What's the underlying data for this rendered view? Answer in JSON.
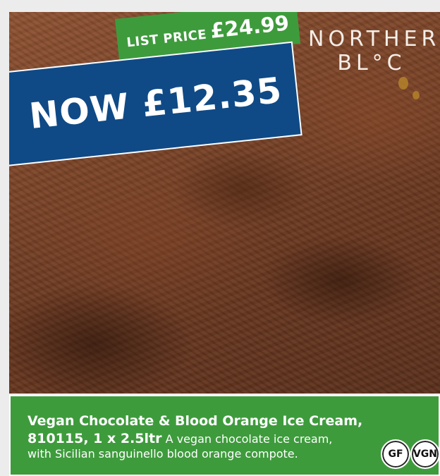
{
  "promo": {
    "list_price_label": "LIST PRICE",
    "list_price_value": "£24.99",
    "now_price": "NOW £12.35"
  },
  "brand": {
    "line1": "NORTHERN",
    "line2": "BL°C"
  },
  "product": {
    "name": "Vegan Chocolate & Blood Orange Ice Cream,",
    "code_size": "810115, 1 x 2.5ltr",
    "description": "A vegan chocolate ice cream, with Sicilian sanguinello blood orange compote."
  },
  "badges": [
    "GF",
    "VGN"
  ],
  "colors": {
    "green": "#3e9b3c",
    "blue": "#0f4a86",
    "chocolate": "#7a4327"
  }
}
